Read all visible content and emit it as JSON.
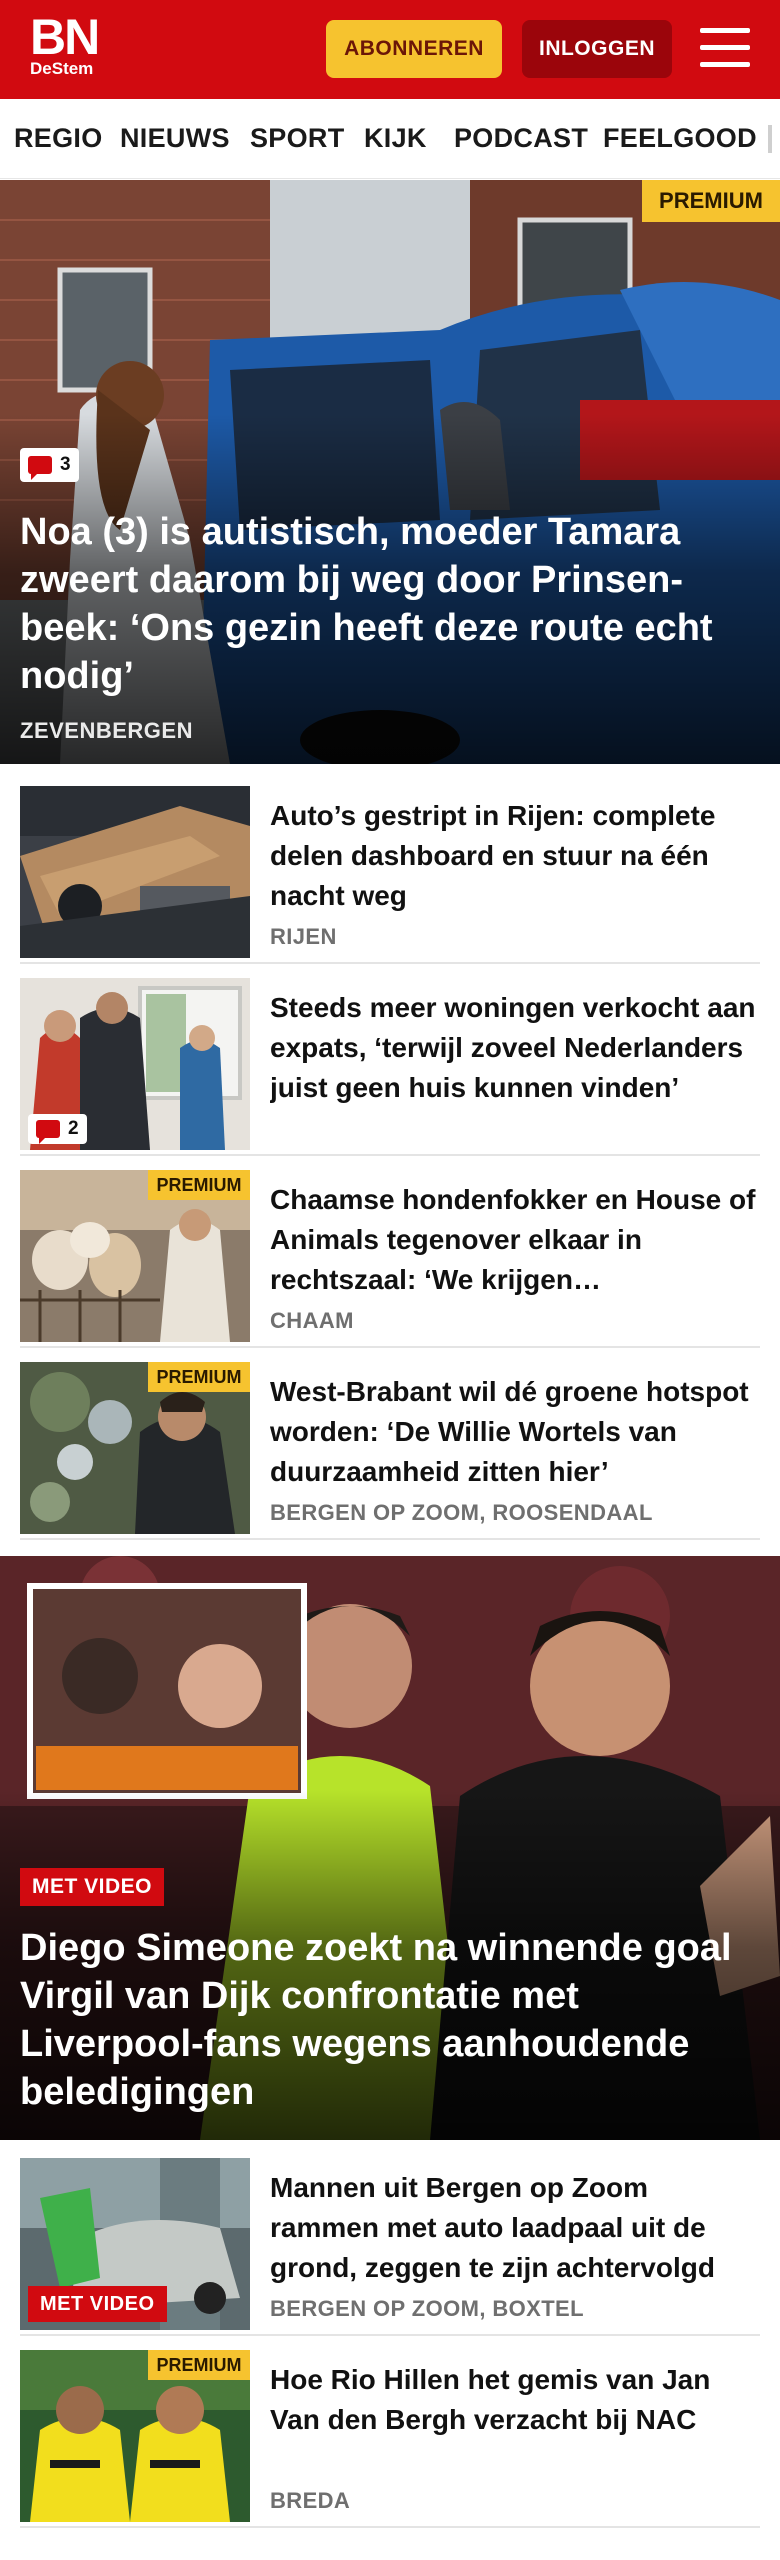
{
  "brand": {
    "logo_main": "BN",
    "logo_sub": "DeStem",
    "primary_color": "#d10a10",
    "accent_color": "#f6c32f"
  },
  "header": {
    "subscribe_label": "ABONNEREN",
    "login_label": "INLOGGEN",
    "menu_icon": "hamburger-icon"
  },
  "nav": {
    "items": [
      "REGIO",
      "NIEUWS",
      "SPORT",
      "KIJK",
      "PODCAST",
      "FEELGOOD"
    ]
  },
  "hero1": {
    "premium_label": "PREMIUM",
    "comments": "3",
    "title": "Noa (3) is autistisch, moeder Tamara zweert daarom bij weg door Prinsen­beek: ‘Ons gezin heeft deze route echt nodig’",
    "location": "ZEVENBERGEN"
  },
  "articles1": [
    {
      "title": "Auto’s gestript in Rijen: complete delen dashboard en stuur na één nacht weg",
      "location": "RIJEN"
    },
    {
      "title": "Steeds meer woningen verkocht aan expats, ‘terwijl zoveel Nederlanders juist geen huis kunnen vinden’",
      "location": "",
      "comments": "2"
    },
    {
      "title": "Chaamse hondenfokker en House of Animals tegenover elkaar in rechtszaal: ‘We krijgen doodsbedreigingen’",
      "location": "CHAAM",
      "premium_label": "PREMIUM"
    },
    {
      "title": "West-Brabant wil dé groene hotspot worden: ‘De Willie Wortels van duurzaamheid zitten hier’",
      "location": "BERGEN OP ZOOM, ROOSENDAAL",
      "premium_label": "PREMIUM"
    }
  ],
  "hero2": {
    "video_label": "MET VIDEO",
    "title": "Diego Simeone zoekt na winnende goal Virgil van Dijk confrontatie met Liverpool-fans wegens aanhoudende beledigingen"
  },
  "articles2": [
    {
      "title": "Mannen uit Bergen op Zoom rammen met auto laadpaal uit de grond, zeggen te zijn achtervolgd",
      "location": "BERGEN OP ZOOM, BOXTEL",
      "video_label": "MET VIDEO"
    },
    {
      "title": "Hoe Rio Hillen het gemis van Jan Van den Bergh verzacht bij NAC",
      "location": "BREDA",
      "premium_label": "PREMIUM"
    }
  ]
}
